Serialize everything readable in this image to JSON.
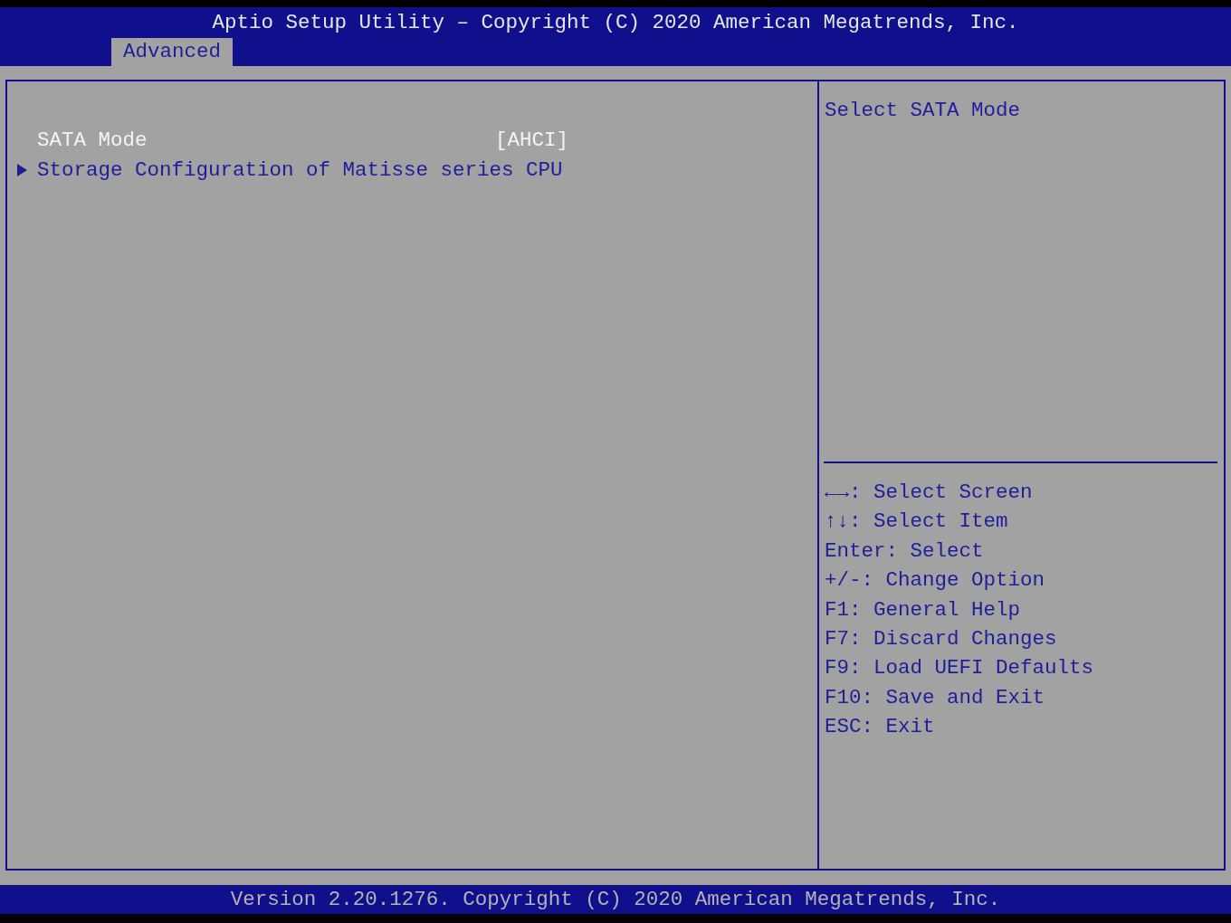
{
  "header": {
    "title": "Aptio Setup Utility – Copyright (C) 2020 American Megatrends, Inc."
  },
  "tabs": [
    {
      "label": "Advanced",
      "selected": true
    }
  ],
  "menu_items": [
    {
      "kind": "setting",
      "label": "SATA Mode",
      "value": "[AHCI]",
      "selected": true
    },
    {
      "kind": "submenu",
      "label": "Storage Configuration of Matisse series CPU",
      "selected": false
    }
  ],
  "help": {
    "description": "Select SATA Mode",
    "keys": [
      "←→: Select Screen",
      "↑↓: Select Item",
      "Enter: Select",
      "+/-: Change Option",
      "F1: General Help",
      "F7: Discard Changes",
      "F9: Load UEFI Defaults",
      "F10: Save and Exit",
      "ESC: Exit"
    ]
  },
  "footer": {
    "text": "Version 2.20.1276. Copyright (C) 2020 American Megatrends, Inc."
  }
}
